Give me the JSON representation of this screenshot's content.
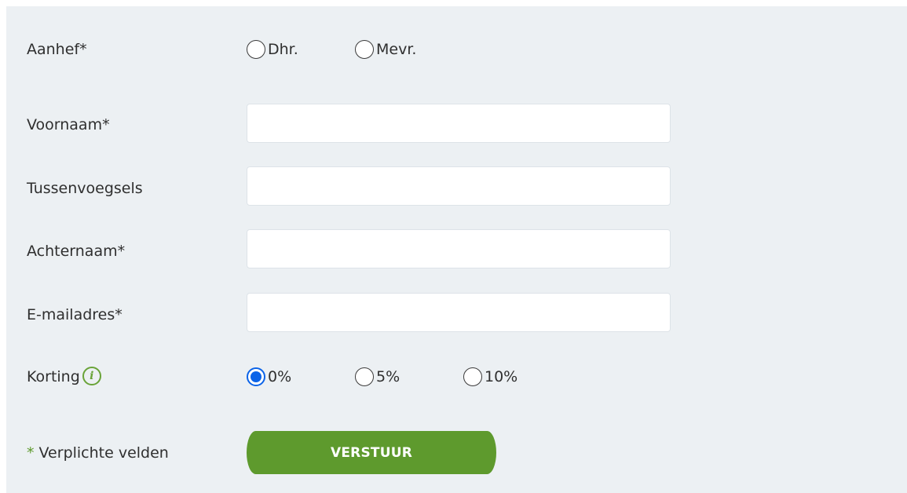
{
  "form": {
    "salutation": {
      "label": "Aanhef*",
      "options": [
        {
          "label": "Dhr.",
          "checked": false
        },
        {
          "label": "Mevr.",
          "checked": false
        }
      ]
    },
    "first_name": {
      "label": "Voornaam*",
      "value": "",
      "placeholder": ""
    },
    "infix": {
      "label": "Tussenvoegsels",
      "value": "",
      "placeholder": ""
    },
    "last_name": {
      "label": "Achternaam*",
      "value": "",
      "placeholder": ""
    },
    "email": {
      "label": "E-mailadres*",
      "value": "",
      "placeholder": ""
    },
    "discount": {
      "label": "Korting",
      "info_icon": "info-icon",
      "info_glyph": "i",
      "options": [
        {
          "label": "0%",
          "checked": true
        },
        {
          "label": "5%",
          "checked": false
        },
        {
          "label": "10%",
          "checked": false
        }
      ]
    },
    "required_note": {
      "star": "*",
      "text": " Verplichte velden"
    },
    "submit_label": "VERSTUUR"
  },
  "colors": {
    "panel_background": "#ecf0f3",
    "submit_green": "#5e9a2d",
    "info_green": "#69a338",
    "radio_checked_blue": "#0b63e8"
  }
}
